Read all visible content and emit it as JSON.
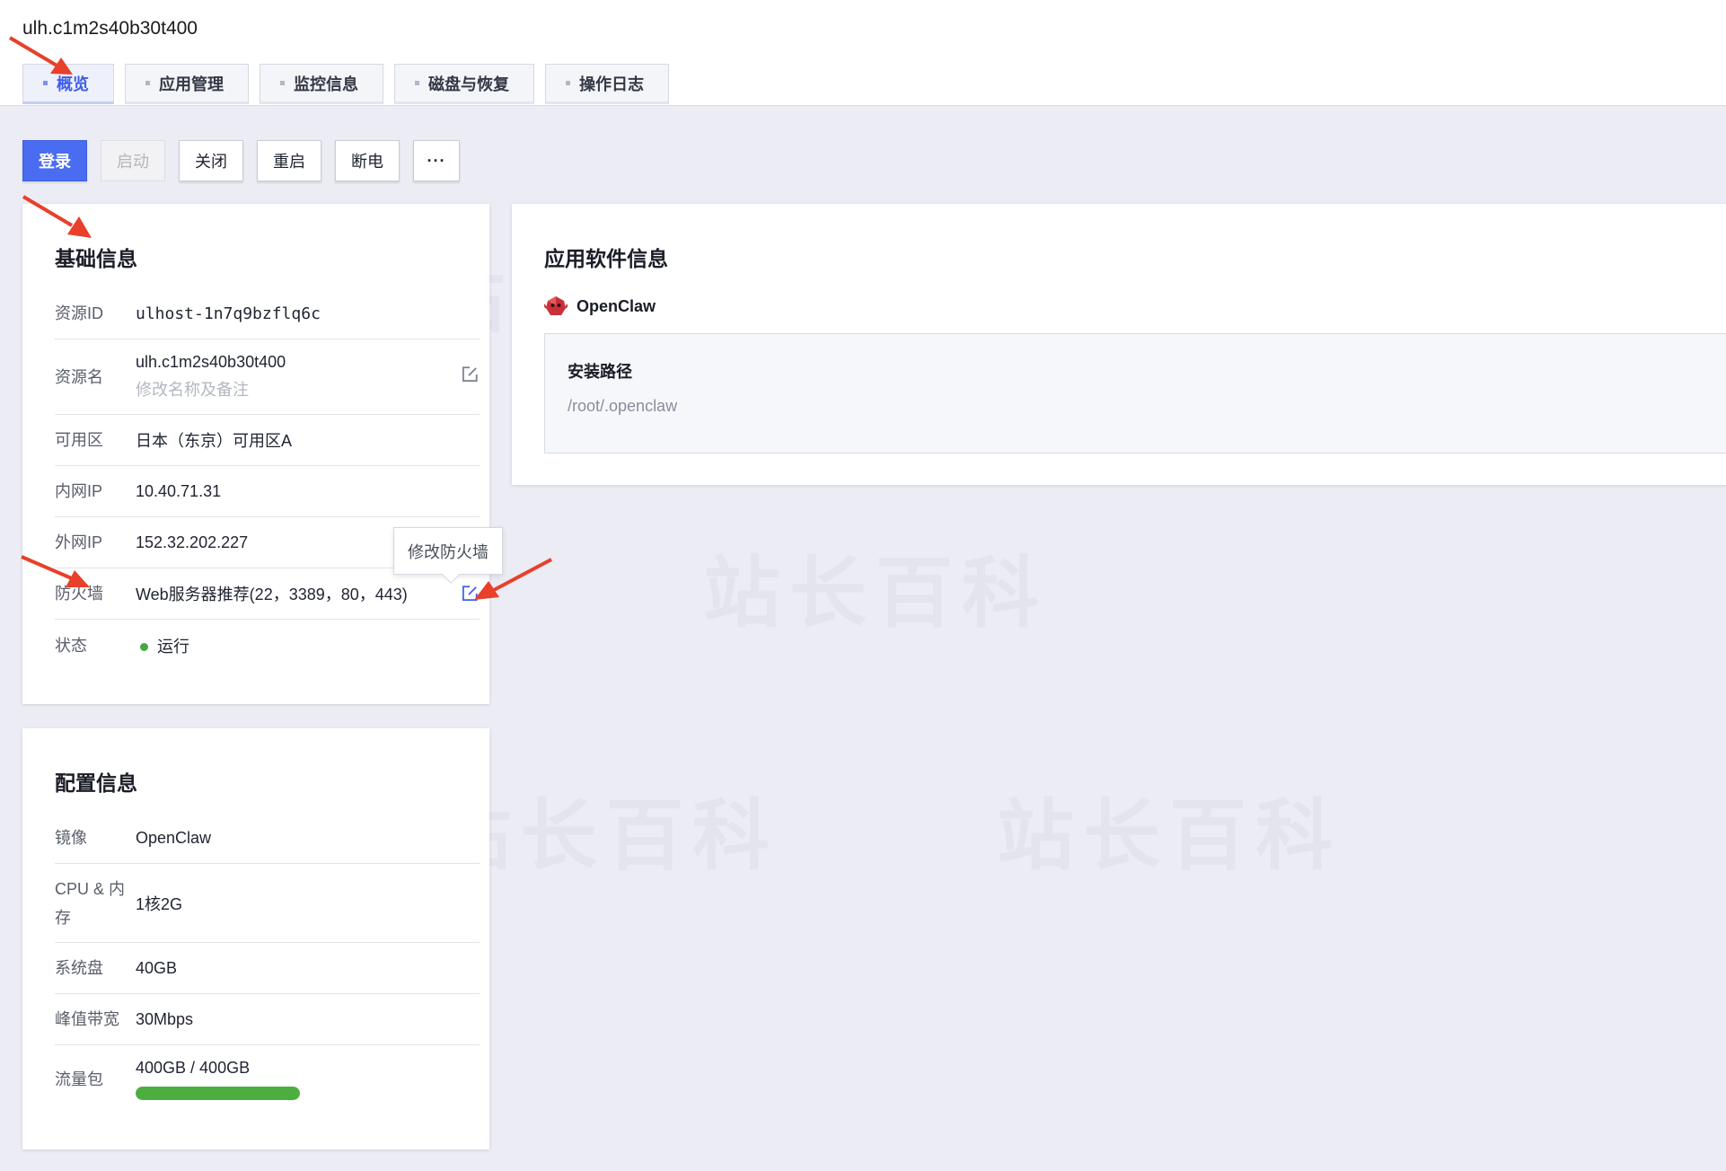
{
  "header": {
    "host_title": "ulh.c1m2s40b30t400"
  },
  "tabs": [
    "概览",
    "应用管理",
    "监控信息",
    "磁盘与恢复",
    "操作日志"
  ],
  "actions": {
    "login": "登录",
    "start": "启动",
    "close": "关闭",
    "restart": "重启",
    "poweroff": "断电",
    "more": "···"
  },
  "basic_info": {
    "title": "基础信息",
    "resource_id": {
      "label": "资源ID",
      "value": "ulhost-1n7q9bzflq6c"
    },
    "resource_name": {
      "label": "资源名",
      "value": "ulh.c1m2s40b30t400",
      "hint": "修改名称及备注"
    },
    "zone": {
      "label": "可用区",
      "value": "日本（东京）可用区A"
    },
    "private_ip": {
      "label": "内网IP",
      "value": "10.40.71.31"
    },
    "public_ip": {
      "label": "外网IP",
      "value": "152.32.202.227"
    },
    "firewall": {
      "label": "防火墙",
      "value": "Web服务器推荐(22，3389，80，443)",
      "tooltip": "修改防火墙"
    },
    "status": {
      "label": "状态",
      "value": "运行",
      "color": "#43a83e"
    }
  },
  "config_info": {
    "title": "配置信息",
    "image": {
      "label": "镜像",
      "value": "OpenClaw"
    },
    "cpu_mem": {
      "label": "CPU & 内存",
      "value": "1核2G"
    },
    "system_disk": {
      "label": "系统盘",
      "value": "40GB"
    },
    "bandwidth": {
      "label": "峰值带宽",
      "value": "30Mbps"
    },
    "traffic": {
      "label": "流量包",
      "value": "400GB / 400GB",
      "used_fraction": 1.0
    }
  },
  "app_info": {
    "title": "应用软件信息",
    "app_name": "OpenClaw",
    "install_path_label": "安装路径",
    "install_path": "/root/.openclaw"
  },
  "watermark": {
    "text": "站长百科"
  },
  "colors": {
    "accent": "#4a6cf0",
    "status_green": "#43a83e",
    "annotation_arrow": "#e8402a"
  }
}
